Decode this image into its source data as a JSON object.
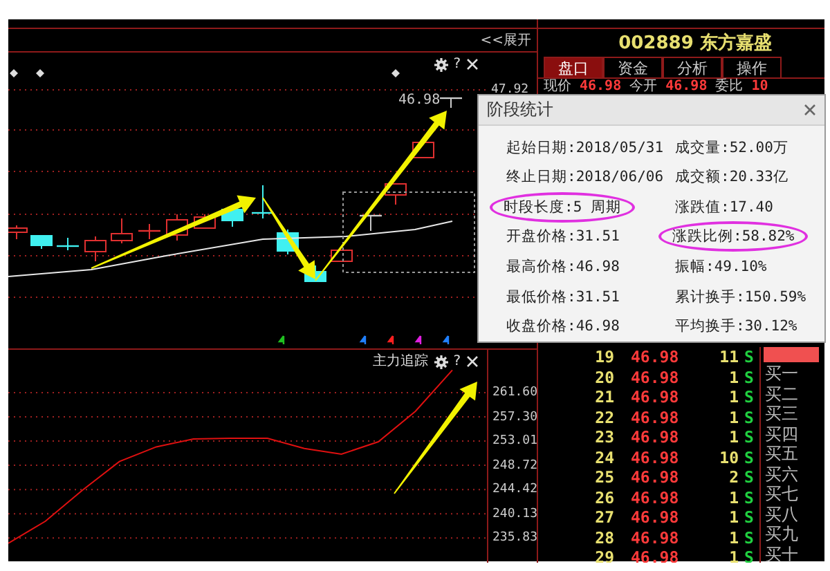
{
  "top_bar": {
    "expand_button": "<<展开"
  },
  "price_chart": {
    "help_glyph": "?",
    "price_label": "46.98",
    "axis_label": "47.92"
  },
  "indicator_panel": {
    "title": "主力追踪",
    "help_glyph": "?",
    "chart_data": {
      "type": "line",
      "series": [
        {
          "color": "#e01010",
          "values": [
            234.9,
            238.8,
            244.3,
            249.4,
            252.0,
            253.4,
            253.5,
            253.5,
            251.7,
            250.7,
            252.9,
            258.3,
            265.6
          ]
        }
      ],
      "ylim": [
        231.45,
        269.2
      ],
      "grid": true,
      "yticks": [
        {
          "value": 261.6,
          "label": "261.60"
        },
        {
          "value": 257.3,
          "label": "257.30"
        },
        {
          "value": 253.01,
          "label": "253.01"
        },
        {
          "value": 248.72,
          "label": "248.72"
        },
        {
          "value": 244.42,
          "label": "244.42"
        },
        {
          "value": 240.13,
          "label": "240.13"
        },
        {
          "value": 235.83,
          "label": "235.83"
        }
      ]
    }
  },
  "quote_panel": {
    "title": "002889 东方嘉盛",
    "tabs": [
      {
        "label": "盘口",
        "selected": true
      },
      {
        "label": "资金",
        "selected": false
      },
      {
        "label": "分析",
        "selected": false
      },
      {
        "label": "操作",
        "selected": false
      }
    ],
    "quote_row": [
      {
        "text": "现价",
        "kind": "label"
      },
      {
        "text": "46.98",
        "kind": "price"
      },
      {
        "text": "今开",
        "kind": "label"
      },
      {
        "text": "46.98",
        "kind": "price"
      },
      {
        "text": "委比",
        "kind": "label"
      },
      {
        "text": "10",
        "kind": "price"
      }
    ],
    "trades": [
      {
        "index": "19",
        "price": "46.98",
        "volume": "11",
        "side": "S"
      },
      {
        "index": "20",
        "price": "46.98",
        "volume": "1",
        "side": "S"
      },
      {
        "index": "21",
        "price": "46.98",
        "volume": "1",
        "side": "S"
      },
      {
        "index": "22",
        "price": "46.98",
        "volume": "1",
        "side": "S"
      },
      {
        "index": "23",
        "price": "46.98",
        "volume": "1",
        "side": "S"
      },
      {
        "index": "24",
        "price": "46.98",
        "volume": "10",
        "side": "S"
      },
      {
        "index": "25",
        "price": "46.98",
        "volume": "2",
        "side": "S"
      },
      {
        "index": "26",
        "price": "46.98",
        "volume": "1",
        "side": "S"
      },
      {
        "index": "27",
        "price": "46.98",
        "volume": "1",
        "side": "S"
      },
      {
        "index": "28",
        "price": "46.98",
        "volume": "1",
        "side": "S"
      },
      {
        "index": "29",
        "price": "46.98",
        "volume": "1",
        "side": "S"
      }
    ],
    "order_levels": [
      "买一",
      "买二",
      "买三",
      "买四",
      "买五",
      "买六",
      "买七",
      "买八",
      "买九",
      "买十"
    ]
  },
  "dialog": {
    "title": "阶段统计",
    "items": [
      {
        "text": "起始日期:2018/05/31",
        "highlighted": false
      },
      {
        "text": "成交量:52.00万",
        "highlighted": false
      },
      {
        "text": "终止日期:2018/06/06",
        "highlighted": false
      },
      {
        "text": "成交额:20.33亿",
        "highlighted": false
      },
      {
        "text": "时段长度:5 周期",
        "highlighted": true
      },
      {
        "text": "涨跌值:17.40",
        "highlighted": false
      },
      {
        "text": "开盘价格:31.51",
        "highlighted": false
      },
      {
        "text": "涨跌比例:58.82%",
        "highlighted": true
      },
      {
        "text": "最高价格:46.98",
        "highlighted": false
      },
      {
        "text": "振幅:49.10%",
        "highlighted": false
      },
      {
        "text": "最低价格:31.51",
        "highlighted": false
      },
      {
        "text": "累计换手:150.59%",
        "highlighted": false
      },
      {
        "text": "收盘价格:46.98",
        "highlighted": false
      },
      {
        "text": "平均换手:30.12%",
        "highlighted": false
      }
    ]
  }
}
